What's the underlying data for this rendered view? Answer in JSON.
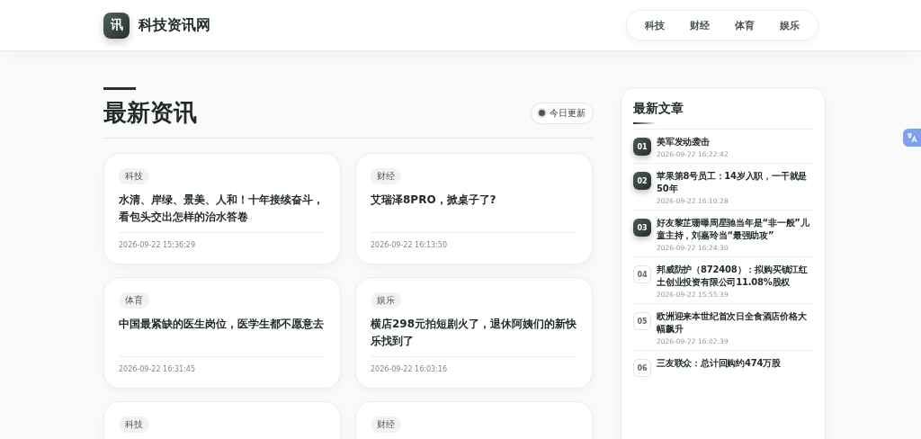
{
  "header": {
    "logo": "讯",
    "site_name": "科技资讯网",
    "nav": [
      {
        "label": "科技"
      },
      {
        "label": "财经"
      },
      {
        "label": "体育"
      },
      {
        "label": "娱乐"
      }
    ]
  },
  "main": {
    "title": "最新资讯",
    "badge": "今日更新",
    "cards": [
      {
        "tag": "科技",
        "title": "水清、岸绿、景美、人和！十年接续奋斗，看包头交出怎样的治水答卷",
        "time": "2026-09-22 15:36:29"
      },
      {
        "tag": "财经",
        "title": "艾瑞泽8PRO，掀桌子了?",
        "time": "2026-09-22 16:13:50"
      },
      {
        "tag": "体育",
        "title": "中国最紧缺的医生岗位，医学生都不愿意去",
        "time": "2026-09-22 16:31:45"
      },
      {
        "tag": "娱乐",
        "title": "横店298元拍短剧火了，退休阿姨们的新快乐找到了",
        "time": "2026-09-22 16:03:16"
      },
      {
        "tag": "科技"
      },
      {
        "tag": "财经"
      }
    ]
  },
  "sidebar": {
    "title": "最新文章",
    "items": [
      {
        "rank": "01",
        "kind": "top",
        "title": "美军发动袭击",
        "time": "2026-09-22 16:22:42"
      },
      {
        "rank": "02",
        "kind": "top",
        "title": "苹果第8号员工：14岁入职，一干就是50年",
        "time": "2026-09-22 16:10:28"
      },
      {
        "rank": "03",
        "kind": "top",
        "title": "好友黎芷珊曝周星驰当年是“非一般”儿童主持，刘嘉玲当“最强助攻”",
        "time": "2026-09-22 16:24:30"
      },
      {
        "rank": "04",
        "kind": "normal",
        "title": "邦威防护（872408）：拟购买镇江红土创业投资有限公司11.08%股权",
        "time": "2026-09-22 15:55:39"
      },
      {
        "rank": "05",
        "kind": "normal",
        "title": "欧洲迎来本世纪首次日全食酒店价格大幅飙升",
        "time": "2026-09-22 16:02:39"
      },
      {
        "rank": "06",
        "kind": "normal",
        "title": "三友联众：总计回购约474万股"
      }
    ]
  }
}
